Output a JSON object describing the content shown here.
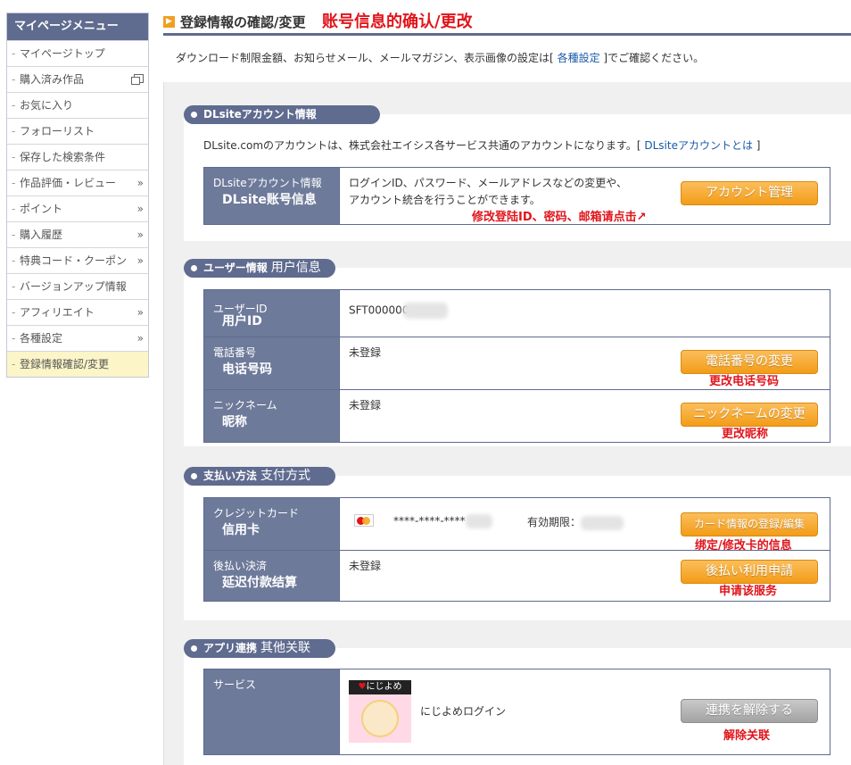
{
  "sidebar": {
    "title": "マイページメニュー",
    "items": [
      {
        "label": "マイページトップ"
      },
      {
        "label": "購入済み作品"
      },
      {
        "label": "お気に入り"
      },
      {
        "label": "フォローリスト"
      },
      {
        "label": "保存した検索条件"
      },
      {
        "label": "作品評価・レビュー"
      },
      {
        "label": "ポイント"
      },
      {
        "label": "購入履歴"
      },
      {
        "label": "特典コード・クーポン"
      },
      {
        "label": "バージョンアップ情報"
      },
      {
        "label": "アフィリエイト"
      },
      {
        "label": "各種設定"
      },
      {
        "label": "登録情報確認/変更"
      }
    ],
    "chevron": "»"
  },
  "header": {
    "title_jp": "登録情報の確認/変更",
    "title_cn": "账号信息的确认/更改",
    "desc_before": "ダウンロード制限金額、お知らせメール、メールマガジン、表示画像の設定は[",
    "desc_link": "各種設定",
    "desc_after": "]でご確認ください。"
  },
  "account": {
    "head": "DLsiteアカウント情報",
    "info_before": "DLsite.comのアカウントは、株式会社エイシス各サービス共通のアカウントになります。[",
    "info_link": "DLsiteアカウントとは",
    "info_after": "]",
    "label_jp": "DLsiteアカウント情報",
    "label_cn": "DLsite账号信息",
    "value_line1": "ログインID、パスワード、メールアドレスなどの変更や、",
    "value_line2": "アカウント統合を行うことができます。",
    "button": "アカウント管理",
    "note": "修改登陆ID、密码、邮箱请点击↗"
  },
  "user": {
    "head": "ユーザー情報",
    "head_cn": "用户信息",
    "rows": [
      {
        "label_jp": "ユーザーID",
        "label_cn": "用户ID",
        "value": "SFT000000"
      },
      {
        "label_jp": "電話番号",
        "label_cn": "电话号码",
        "value": "未登録",
        "button": "電話番号の変更",
        "note": "更改电话号码"
      },
      {
        "label_jp": "ニックネーム",
        "label_cn": "昵称",
        "value": "未登録",
        "button": "ニックネームの変更",
        "note": "更改昵称"
      }
    ]
  },
  "payment": {
    "head": "支払い方法",
    "head_cn": "支付方式",
    "rows": [
      {
        "label_jp": "クレジットカード",
        "label_cn": "信用卡",
        "card_number": "****-****-****",
        "expiry_label": "有効期限：",
        "button": "カード情報の登録/編集",
        "note": "绑定/修改卡的信息"
      },
      {
        "label_jp": "後払い決済",
        "label_cn": "延迟付款结算",
        "value": "未登録",
        "button": "後払い利用申請",
        "note": "申请该服务"
      }
    ]
  },
  "apps": {
    "head": "アプリ連携",
    "head_cn": "其他关联",
    "label": "サービス",
    "app_badge": "にじよめ",
    "app_name": "にじよめログイン",
    "button": "連携を解除する",
    "note": "解除关联"
  },
  "colors": {
    "nav": "#5f6b8f",
    "accent_orange": "#f39c17",
    "note_red": "#e0151b",
    "active_bg": "#fbf5c8"
  },
  "icons": [
    "play-icon",
    "new-window-icon",
    "chevron-right-icon",
    "mastercard-icon"
  ]
}
